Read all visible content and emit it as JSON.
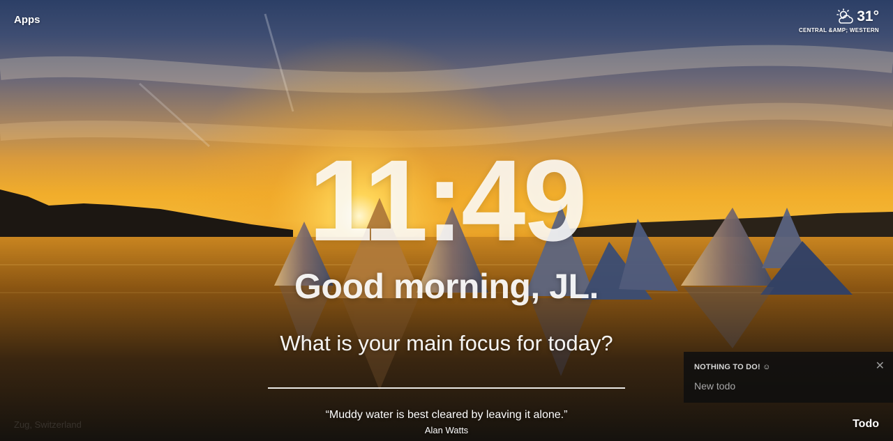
{
  "top_left": {
    "apps_label": "Apps"
  },
  "weather": {
    "icon": "partly-cloudy-icon",
    "temperature": "31°",
    "location": "CENTRAL &AMP; WESTERN"
  },
  "center": {
    "time": "11:49",
    "greeting": "Good morning, JL.",
    "focus_question": "What is your main focus for today?",
    "focus_value": ""
  },
  "quote": {
    "text": "“Muddy water is best cleared by leaving it alone.”",
    "author": "Alan Watts"
  },
  "background": {
    "location": "Zug, Switzerland"
  },
  "todo": {
    "title": "NOTHING TO DO! ☺",
    "new_placeholder": "New todo",
    "close_icon": "close-icon",
    "toggle_label": "Todo"
  },
  "colors": {
    "sky_top": "#2c3f66",
    "sun_glow": "#f4b634",
    "panel_bg": "#0f0f0f"
  }
}
